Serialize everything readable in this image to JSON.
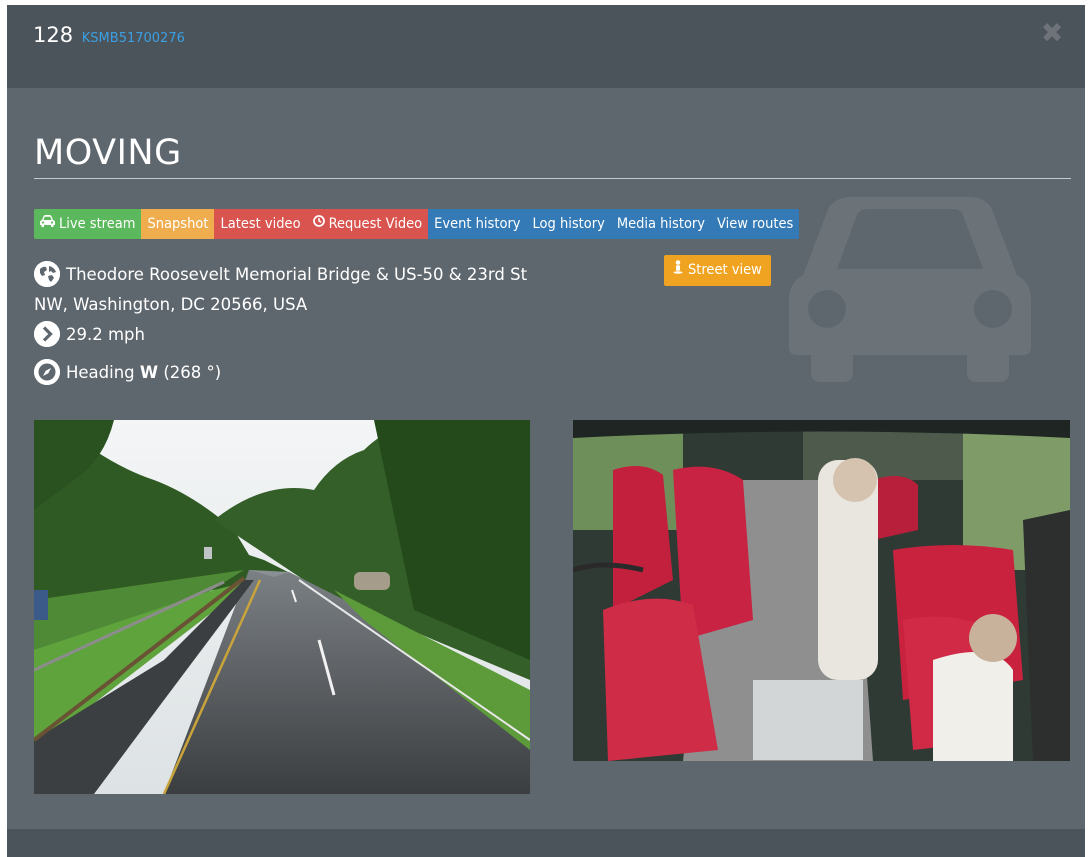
{
  "header": {
    "vehicle_number": "128",
    "device_id": "KSMB51700276",
    "close_symbol": "✖"
  },
  "status": "MOVING",
  "actions": {
    "live_stream": "Live stream",
    "snapshot": "Snapshot",
    "latest_video": "Latest video",
    "request_video": "Request Video",
    "event_history": "Event history",
    "log_history": "Log history",
    "media_history": "Media history",
    "view_routes": "View routes"
  },
  "street_view": "Street view",
  "location": {
    "address_line1": "Theodore Roosevelt Memorial Bridge & US-50 & 23rd St",
    "address_line2": "NW, Washington, DC 20566, USA",
    "speed": "29.2 mph",
    "heading_label": "Heading",
    "heading_dir": "W",
    "heading_deg": "(268 °)"
  },
  "colors": {
    "green": "#5cb85c",
    "orange": "#f0ad4e",
    "red": "#d9534f",
    "blue": "#337ab7",
    "accent_link": "#3b9fe2",
    "modal_bg": "#5f676e",
    "header_bg": "#4c545b"
  },
  "cameras": [
    {
      "name": "front-road-camera"
    },
    {
      "name": "interior-cabin-camera"
    }
  ]
}
